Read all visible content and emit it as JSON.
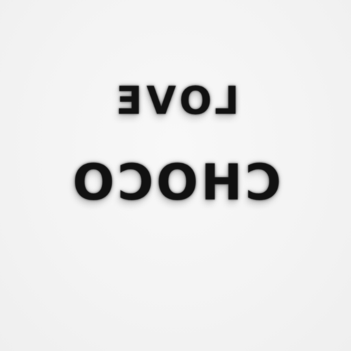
{
  "image": {
    "lines": [
      {
        "text": "LOVE",
        "mirrored": true
      },
      {
        "text": "CHOCO",
        "mirrored": true
      }
    ],
    "colors": {
      "background": "#f4f4f4",
      "text": "#111111"
    }
  }
}
